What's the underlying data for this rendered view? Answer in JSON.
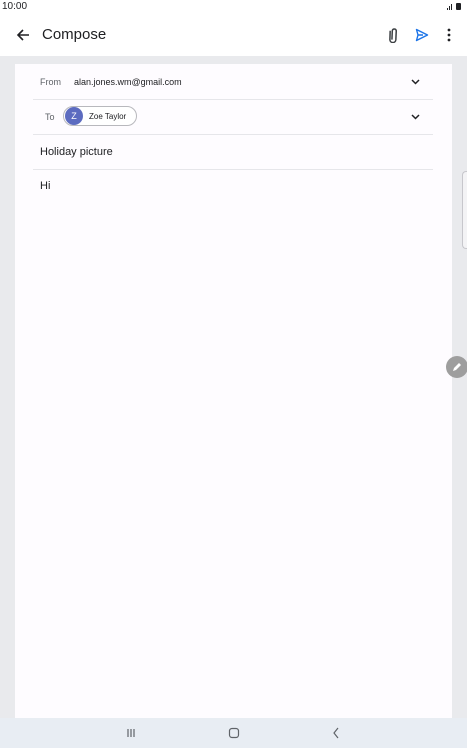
{
  "status_bar": {
    "time": "10:00",
    "icons": [
      "signal-icon",
      "battery-icon"
    ]
  },
  "app_bar": {
    "title": "Compose",
    "icons": [
      "back-arrow-icon",
      "attach-icon",
      "send-icon",
      "more-vert-icon"
    ],
    "accent_color": "#1a73e8"
  },
  "compose": {
    "from_label": "From",
    "from_value": "alan.jones.wm@gmail.com",
    "to_label": "To",
    "recipient": {
      "initial": "Z",
      "name": "Zoe Taylor",
      "avatar_color": "#5c6bc0"
    },
    "subject": "Holiday picture",
    "body": "Hi"
  },
  "nav_bar": {
    "icons": [
      "recent-apps-icon",
      "home-icon",
      "back-icon"
    ]
  }
}
